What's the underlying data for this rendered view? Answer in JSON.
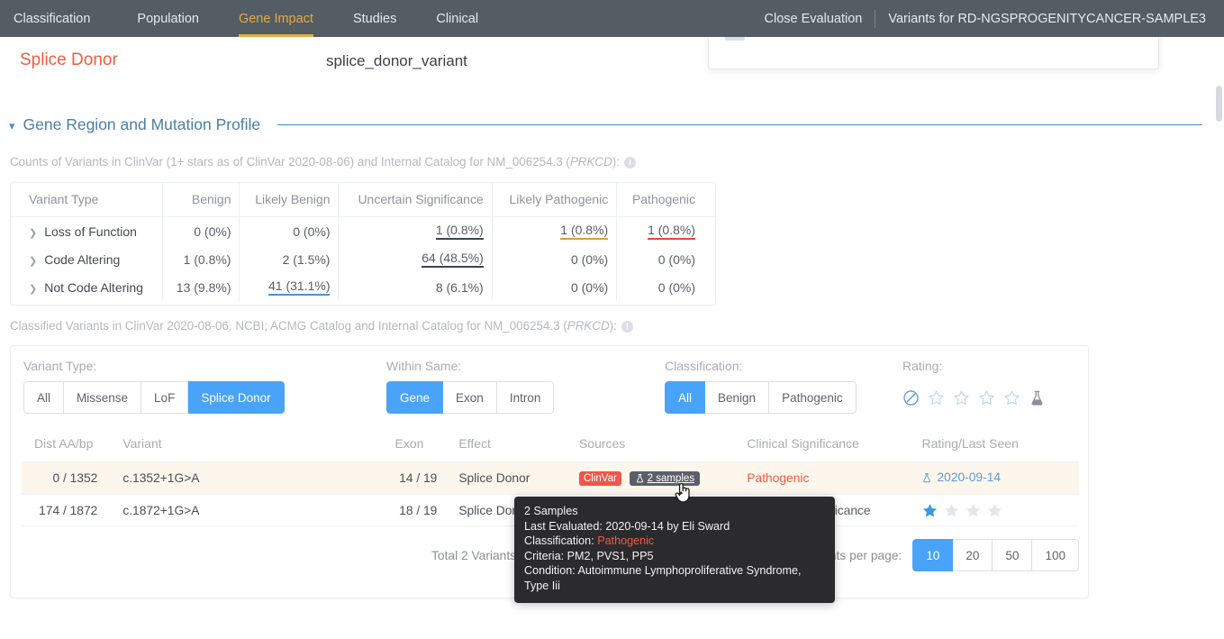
{
  "nav": {
    "tabs": [
      {
        "label": "Classification",
        "active": false
      },
      {
        "label": "Population",
        "active": false
      },
      {
        "label": "Gene Impact",
        "active": true
      },
      {
        "label": "Studies",
        "active": false
      },
      {
        "label": "Clinical",
        "active": false
      }
    ],
    "close_evaluation": "Close Evaluation",
    "sample_title": "Variants for RD-NGSPROGENITYCANCER-SAMPLE3",
    "active_color": "#e4ac3a",
    "bg_color": "#545c64"
  },
  "variant_header": {
    "effect_title": "Splice Donor",
    "effect_title_color": "#f05b40",
    "consequence": "splice_donor_variant"
  },
  "section": {
    "title": "Gene Region and Mutation Profile",
    "chevron": "chevron-down",
    "rule_color": "#3f8bc4"
  },
  "counts": {
    "caption_pre": "Counts of Variants in ClinVar (1+ stars as of ClinVar 2020-08-06) and Internal Catalog for NM_006254.3 (",
    "caption_gene": "PRKCD",
    "caption_post": "):",
    "info_glyph": "i",
    "columns": [
      "Variant Type",
      "Benign",
      "Likely Benign",
      "Uncertain Significance",
      "Likely Pathogenic",
      "Pathogenic"
    ],
    "rows": [
      {
        "type": "Loss of Function",
        "cells": [
          {
            "text": "0 (0%)",
            "zero": true,
            "underline": ""
          },
          {
            "text": "0 (0%)",
            "zero": true,
            "underline": ""
          },
          {
            "text": "1 (0.8%)",
            "zero": false,
            "underline": "dark"
          },
          {
            "text": "1 (0.8%)",
            "zero": false,
            "underline": "orange"
          },
          {
            "text": "1 (0.8%)",
            "zero": false,
            "underline": "red"
          }
        ]
      },
      {
        "type": "Code Altering",
        "cells": [
          {
            "text": "1 (0.8%)",
            "zero": false,
            "underline": ""
          },
          {
            "text": "2 (1.5%)",
            "zero": false,
            "underline": ""
          },
          {
            "text": "64 (48.5%)",
            "zero": false,
            "underline": "dark"
          },
          {
            "text": "0 (0%)",
            "zero": true,
            "underline": ""
          },
          {
            "text": "0 (0%)",
            "zero": true,
            "underline": ""
          }
        ]
      },
      {
        "type": "Not Code Altering",
        "cells": [
          {
            "text": "13 (9.8%)",
            "zero": false,
            "underline": ""
          },
          {
            "text": "41 (31.1%)",
            "zero": false,
            "underline": "blue"
          },
          {
            "text": "8 (6.1%)",
            "zero": false,
            "underline": ""
          },
          {
            "text": "0 (0%)",
            "zero": true,
            "underline": ""
          },
          {
            "text": "0 (0%)",
            "zero": true,
            "underline": ""
          }
        ]
      }
    ]
  },
  "classified": {
    "caption_pre": "Classified Variants in ClinVar 2020-08-06, NCBI; ACMG Catalog and Internal Catalog for NM_006254.3 (",
    "caption_gene": "PRKCD",
    "caption_post": "):",
    "info_glyph": "i"
  },
  "filters": {
    "variant_type": {
      "label": "Variant Type:",
      "options": [
        "All",
        "Missense",
        "LoF",
        "Splice Donor"
      ],
      "selected": "Splice Donor"
    },
    "within_same": {
      "label": "Within Same:",
      "options": [
        "Gene",
        "Exon",
        "Intron"
      ],
      "selected": "Gene"
    },
    "classification": {
      "label": "Classification:",
      "options": [
        "All",
        "Benign",
        "Pathogenic"
      ],
      "selected": "All"
    },
    "rating": {
      "label": "Rating:",
      "icons": [
        "no-entry-icon",
        "star-outline-icon",
        "star-outline-icon",
        "star-outline-icon",
        "star-outline-icon",
        "flask-icon"
      ]
    },
    "selected_color": "#49a3f8"
  },
  "variants_table": {
    "columns": [
      "Dist AA/bp",
      "Variant",
      "Exon",
      "Effect",
      "Sources",
      "Clinical Significance",
      "Rating/Last Seen"
    ],
    "rows": [
      {
        "dist": "0 / 1352",
        "variant": "c.1352+1G>A",
        "exon": "14 / 19",
        "effect": "Splice Donor",
        "sources": [
          {
            "label": "ClinVar",
            "kind": "clinvar"
          },
          {
            "label": "2 samples",
            "kind": "samples"
          }
        ],
        "significance": "Pathogenic",
        "significance_kind": "pathogenic",
        "rating_kind": "date",
        "last_seen": "2020-09-14",
        "stars_filled": 0,
        "highlight": true
      },
      {
        "dist": "174 / 1872",
        "variant": "c.1872+1G>A",
        "exon": "18 / 19",
        "effect": "Splice Donor",
        "sources": [],
        "significance": "Uncertain Significance",
        "significance_kind": "vus",
        "rating_kind": "stars",
        "last_seen": "",
        "stars_filled": 1,
        "highlight": false
      }
    ],
    "total_text": "Total 2 Variants",
    "per_page_label": "Variants per page:",
    "per_page_options": [
      "10",
      "20",
      "50",
      "100"
    ],
    "per_page_selected": "10"
  },
  "tooltip": {
    "title": "2 Samples",
    "last_evaluated": "Last Evaluated: 2020-09-14 by Eli Sward",
    "classification_label": "Classification:",
    "classification_value": "Pathogenic",
    "criteria": "Criteria: PM2, PVS1, PP5",
    "condition": "Condition: Autoimmune Lymphoproliferative Syndrome, Type Iii"
  }
}
